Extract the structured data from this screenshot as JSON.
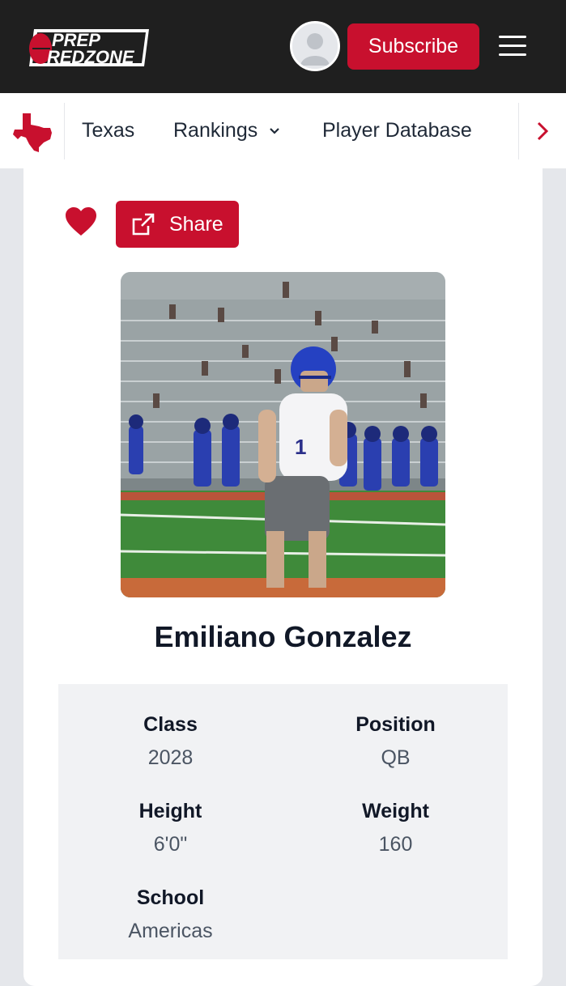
{
  "header": {
    "logo_top": "PREP",
    "logo_bottom": "REDZONE",
    "subscribe_label": "Subscribe"
  },
  "nav": {
    "items": [
      "Texas",
      "Rankings",
      "Player Database"
    ]
  },
  "actions": {
    "share_label": "Share"
  },
  "player": {
    "name": "Emiliano Gonzalez",
    "jersey_number": "1"
  },
  "stats": [
    {
      "label": "Class",
      "value": "2028"
    },
    {
      "label": "Position",
      "value": "QB"
    },
    {
      "label": "Height",
      "value": "6'0\""
    },
    {
      "label": "Weight",
      "value": "160"
    },
    {
      "label": "School",
      "value": "Americas"
    }
  ],
  "colors": {
    "brand_red": "#c8102e",
    "header_bg": "#1f1f1f",
    "page_bg": "#e5e7eb",
    "stats_bg": "#f1f2f4"
  }
}
